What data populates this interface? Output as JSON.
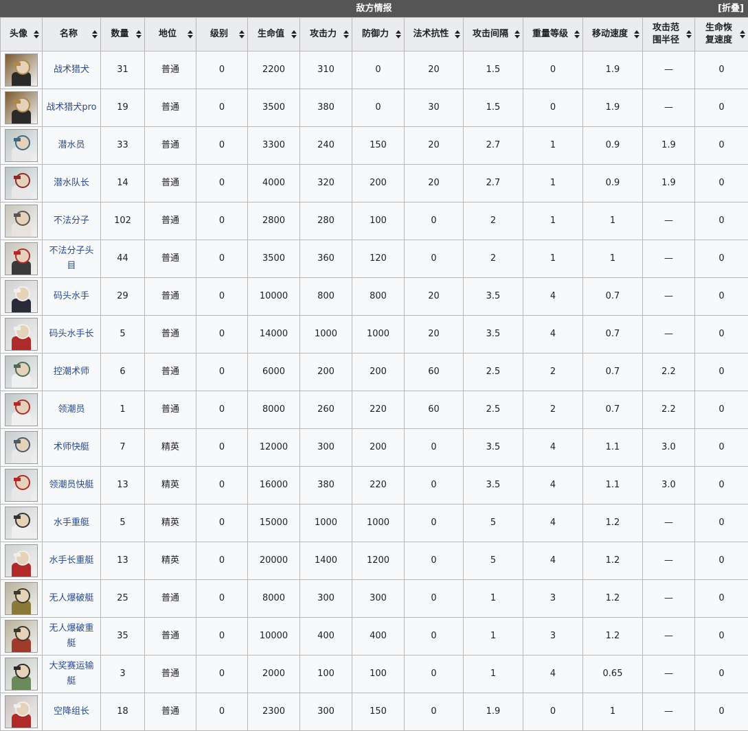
{
  "panel": {
    "title": "敌方情报",
    "fold_label": "[折叠]"
  },
  "headers": [
    "头像",
    "名称",
    "数量",
    "地位",
    "级别",
    "生命值",
    "攻击力",
    "防御力",
    "法术抗性",
    "攻击间隔",
    "重量等级",
    "移动速度",
    "攻击范围半径",
    "生命恢复速度"
  ],
  "rows": [
    {
      "icon": "tactical-hound-icon",
      "name": "战术猎犬",
      "count": "31",
      "rank": "普通",
      "level": "0",
      "hp": "2200",
      "atk": "310",
      "def": "0",
      "res": "20",
      "interval": "1.5",
      "weight": "0",
      "speed": "1.9",
      "range": "—",
      "regen": "0"
    },
    {
      "icon": "tactical-hound-pro-icon",
      "name": "战术猎犬pro",
      "count": "19",
      "rank": "普通",
      "level": "0",
      "hp": "3500",
      "atk": "380",
      "def": "0",
      "res": "30",
      "interval": "1.5",
      "weight": "0",
      "speed": "1.9",
      "range": "—",
      "regen": "0"
    },
    {
      "icon": "diver-icon",
      "name": "潜水员",
      "count": "33",
      "rank": "普通",
      "level": "0",
      "hp": "3300",
      "atk": "240",
      "def": "150",
      "res": "20",
      "interval": "2.7",
      "weight": "1",
      "speed": "0.9",
      "range": "1.9",
      "regen": "0"
    },
    {
      "icon": "diver-captain-icon",
      "name": "潜水队长",
      "count": "14",
      "rank": "普通",
      "level": "0",
      "hp": "4000",
      "atk": "320",
      "def": "200",
      "res": "20",
      "interval": "2.7",
      "weight": "1",
      "speed": "0.9",
      "range": "1.9",
      "regen": "0"
    },
    {
      "icon": "outlaw-icon",
      "name": "不法分子",
      "count": "102",
      "rank": "普通",
      "level": "0",
      "hp": "2800",
      "atk": "280",
      "def": "100",
      "res": "0",
      "interval": "2",
      "weight": "1",
      "speed": "1",
      "range": "—",
      "regen": "0"
    },
    {
      "icon": "outlaw-leader-icon",
      "name": "不法分子头目",
      "count": "44",
      "rank": "普通",
      "level": "0",
      "hp": "3500",
      "atk": "360",
      "def": "120",
      "res": "0",
      "interval": "2",
      "weight": "1",
      "speed": "1",
      "range": "—",
      "regen": "0"
    },
    {
      "icon": "dock-sailor-icon",
      "name": "码头水手",
      "count": "29",
      "rank": "普通",
      "level": "0",
      "hp": "10000",
      "atk": "800",
      "def": "800",
      "res": "20",
      "interval": "3.5",
      "weight": "4",
      "speed": "0.7",
      "range": "—",
      "regen": "0"
    },
    {
      "icon": "dock-sailor-chief-icon",
      "name": "码头水手长",
      "count": "5",
      "rank": "普通",
      "level": "0",
      "hp": "14000",
      "atk": "1000",
      "def": "1000",
      "res": "20",
      "interval": "3.5",
      "weight": "4",
      "speed": "0.7",
      "range": "—",
      "regen": "0"
    },
    {
      "icon": "tide-caster-icon",
      "name": "控潮术师",
      "count": "6",
      "rank": "普通",
      "level": "0",
      "hp": "6000",
      "atk": "200",
      "def": "200",
      "res": "60",
      "interval": "2.5",
      "weight": "2",
      "speed": "0.7",
      "range": "2.2",
      "regen": "0"
    },
    {
      "icon": "tide-leader-icon",
      "name": "领潮员",
      "count": "1",
      "rank": "普通",
      "level": "0",
      "hp": "8000",
      "atk": "260",
      "def": "220",
      "res": "60",
      "interval": "2.5",
      "weight": "2",
      "speed": "0.7",
      "range": "2.2",
      "regen": "0"
    },
    {
      "icon": "caster-speedboat-icon",
      "name": "术师快艇",
      "count": "7",
      "rank": "精英",
      "level": "0",
      "hp": "12000",
      "atk": "300",
      "def": "200",
      "res": "0",
      "interval": "3.5",
      "weight": "4",
      "speed": "1.1",
      "range": "3.0",
      "regen": "0"
    },
    {
      "icon": "tide-leader-speedboat-icon",
      "name": "领潮员快艇",
      "count": "13",
      "rank": "精英",
      "level": "0",
      "hp": "16000",
      "atk": "380",
      "def": "220",
      "res": "0",
      "interval": "3.5",
      "weight": "4",
      "speed": "1.1",
      "range": "3.0",
      "regen": "0"
    },
    {
      "icon": "sailor-heavy-boat-icon",
      "name": "水手重艇",
      "count": "5",
      "rank": "精英",
      "level": "0",
      "hp": "15000",
      "atk": "1000",
      "def": "1000",
      "res": "0",
      "interval": "5",
      "weight": "4",
      "speed": "1.2",
      "range": "—",
      "regen": "0"
    },
    {
      "icon": "sailor-chief-heavy-boat-icon",
      "name": "水手长重艇",
      "count": "13",
      "rank": "精英",
      "level": "0",
      "hp": "20000",
      "atk": "1400",
      "def": "1200",
      "res": "0",
      "interval": "5",
      "weight": "4",
      "speed": "1.2",
      "range": "—",
      "regen": "0"
    },
    {
      "icon": "drone-demolition-boat-icon",
      "name": "无人爆破艇",
      "count": "25",
      "rank": "普通",
      "level": "0",
      "hp": "8000",
      "atk": "300",
      "def": "300",
      "res": "0",
      "interval": "1",
      "weight": "3",
      "speed": "1.2",
      "range": "—",
      "regen": "0"
    },
    {
      "icon": "drone-heavy-demolition-boat-icon",
      "name": "无人爆破重艇",
      "count": "35",
      "rank": "普通",
      "level": "0",
      "hp": "10000",
      "atk": "400",
      "def": "400",
      "res": "0",
      "interval": "1",
      "weight": "3",
      "speed": "1.2",
      "range": "—",
      "regen": "0"
    },
    {
      "icon": "grand-prix-transport-boat-icon",
      "name": "大奖赛运输艇",
      "count": "3",
      "rank": "普通",
      "level": "0",
      "hp": "2000",
      "atk": "100",
      "def": "100",
      "res": "0",
      "interval": "1",
      "weight": "4",
      "speed": "0.65",
      "range": "—",
      "regen": "0"
    },
    {
      "icon": "airborne-squad-leader-icon",
      "name": "空降组长",
      "count": "18",
      "rank": "普通",
      "level": "0",
      "hp": "2300",
      "atk": "300",
      "def": "150",
      "res": "0",
      "interval": "1.9",
      "weight": "0",
      "speed": "1",
      "range": "—",
      "regen": "0"
    }
  ]
}
